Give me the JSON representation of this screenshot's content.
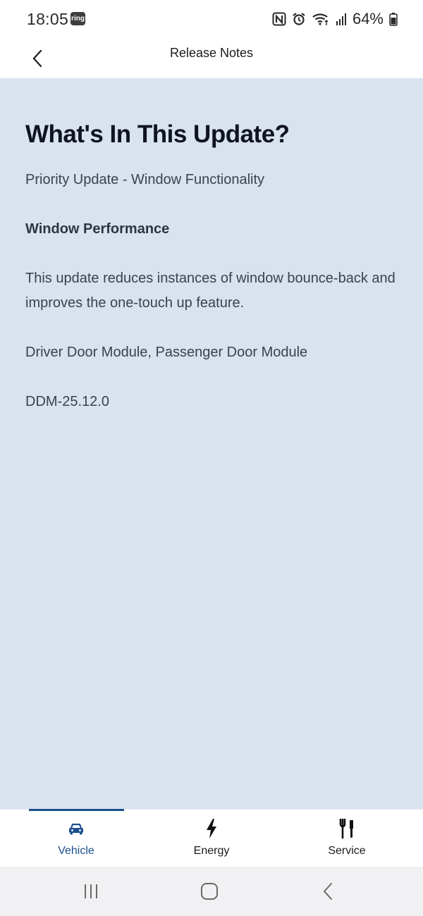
{
  "status_bar": {
    "time": "18:05",
    "ring_badge": "ring",
    "battery": "64%",
    "icons": [
      "nfc-icon",
      "alarm-icon",
      "wifi-icon",
      "signal-icon",
      "battery-icon"
    ]
  },
  "header": {
    "title": "Release Notes",
    "back_icon": "chevron-left-icon"
  },
  "content": {
    "title": "What's In This Update?",
    "subtitle": "Priority Update - Window Functionality",
    "section_heading": "Window Performance",
    "description": "This update reduces instances of window bounce-back and improves the one-touch up feature.",
    "modules": "Driver Door Module, Passenger Door Module",
    "version": "DDM-25.12.0"
  },
  "tabs": [
    {
      "label": "Vehicle",
      "icon": "car-icon",
      "active": true
    },
    {
      "label": "Energy",
      "icon": "lightning-icon",
      "active": false
    },
    {
      "label": "Service",
      "icon": "tools-icon",
      "active": false
    }
  ],
  "colors": {
    "content_background": "#d9e2ef",
    "accent": "#1d4f8f",
    "text_primary": "#0f1420",
    "text_secondary": "#3b4150"
  },
  "nav_bar": {
    "icons": [
      "recents-icon",
      "home-icon",
      "back-icon"
    ]
  }
}
